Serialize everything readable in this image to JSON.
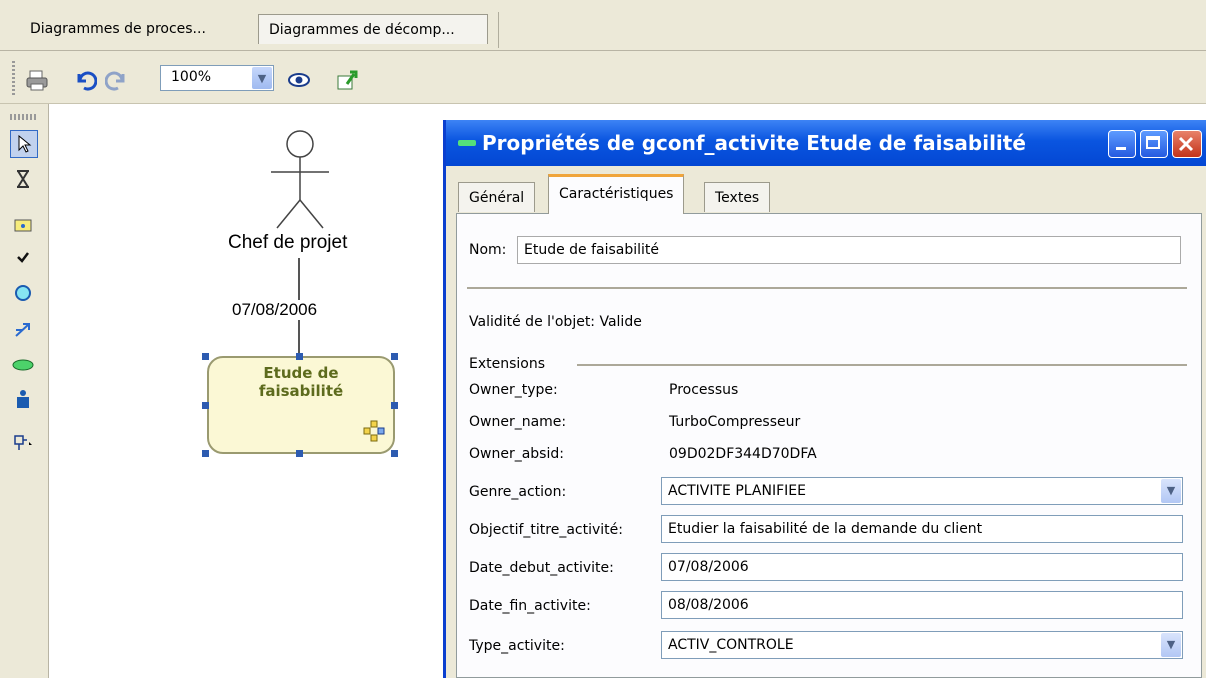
{
  "doc_tabs": [
    "Diagrammes de proces...",
    "Diagrammes de décomp..."
  ],
  "toolbar": {
    "zoom_value": "100%",
    "icons": [
      "print-icon",
      "undo-icon",
      "redo-icon",
      "eye-icon",
      "export-icon"
    ]
  },
  "palette": {
    "icons": [
      "pointer-icon",
      "hourglass-icon",
      "folder-icon",
      "check-icon",
      "circle-icon",
      "arrow-icon",
      "ellipse-icon",
      "person-icon",
      "connector-icon"
    ]
  },
  "canvas": {
    "actor_label": "Chef de projet",
    "date_label": "07/08/2006",
    "activity_label_line1": "Etude de",
    "activity_label_line2": "faisabilité"
  },
  "dialog": {
    "title": "Propriétés de gconf_activite Etude de faisabilité",
    "tabs": [
      "Général",
      "Caractéristiques",
      "Textes"
    ],
    "name_label": "Nom:",
    "name_value": "Etude de faisabilité",
    "validity_text": "Validité de l'objet: Valide",
    "extensions_label": "Extensions",
    "owner_type_label": "Owner_type:",
    "owner_type_value": "Processus",
    "owner_name_label": "Owner_name:",
    "owner_name_value": "TurboCompresseur",
    "owner_absid_label": "Owner_absid:",
    "owner_absid_value": "09D02DF344D70DFA",
    "genre_action_label": "Genre_action:",
    "genre_action_value": "ACTIVITE PLANIFIEE",
    "objectif_label": "Objectif_titre_activité:",
    "objectif_value": "Etudier la faisabilité de la demande du client",
    "date_debut_label": "Date_debut_activite:",
    "date_debut_value": "07/08/2006",
    "date_fin_label": "Date_fin_activite:",
    "date_fin_value": "08/08/2006",
    "type_activite_label": "Type_activite:",
    "type_activite_value": "ACTIV_CONTROLE"
  }
}
